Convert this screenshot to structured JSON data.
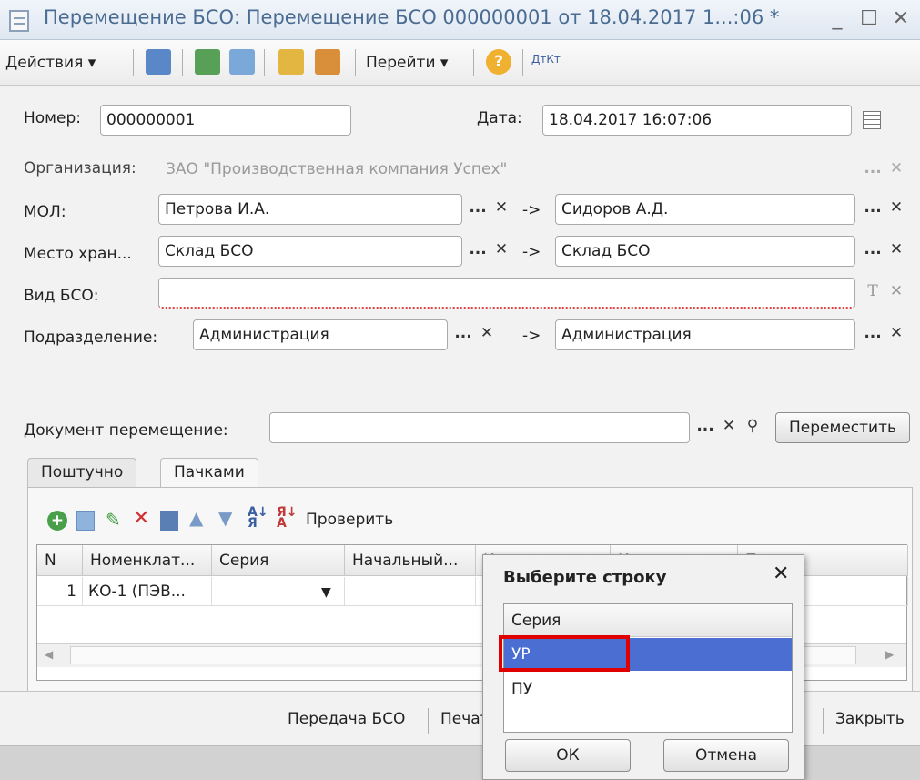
{
  "window": {
    "title": "Перемещение БСО: Перемещение БСО 000000001 от 18.04.2017 1...:06 *",
    "min": "_",
    "max": "☐",
    "close": "✕"
  },
  "toolbar": {
    "actions": "Действия ▾",
    "goto": "Перейти ▾",
    "help": "?",
    "dtkt": "ДтКт"
  },
  "form": {
    "number_label": "Номер:",
    "number_value": "000000001",
    "date_label": "Дата:",
    "date_value": "18.04.2017 16:07:06",
    "org_label": "Организация:",
    "org_value": "ЗАО \"Производственная компания Успех\"",
    "mol_label": "МОЛ:",
    "mol_from": "Петрова И.А.",
    "mol_to": "Сидоров А.Д.",
    "store_label": "Место хран...",
    "store_from": "Склад БСО",
    "store_to": "Склад БСО",
    "kind_label": "Вид БСО:",
    "kind_value": "",
    "dept_label": "Подразделение:",
    "dept_from": "Администрация",
    "dept_to": "Администрация",
    "arrow": "->",
    "dots": "...",
    "x": "✕",
    "t": "T",
    "doc_move_label": "Документ перемещение:",
    "move_button": "Переместить"
  },
  "tabs": [
    "Поштучно",
    "Пачками"
  ],
  "grid_toolbar": {
    "check": "Проверить"
  },
  "grid": {
    "columns": [
      "N",
      "Номенклат...",
      "Серия",
      "Начальный...",
      "К",
      "К",
      "П...ока"
    ],
    "rows": [
      [
        "1",
        "КО-1 (ПЭВ...",
        "",
        "",
        "",
        "",
        ""
      ]
    ]
  },
  "statusbar": {
    "transfer": "Передача БСО",
    "print": "Печать",
    "close": "Закрыть"
  },
  "popup": {
    "title": "Выберите строку",
    "column": "Серия",
    "items": [
      "УР",
      "ПУ"
    ],
    "ok": "ОК",
    "cancel": "Отмена",
    "selected_color": "#4a6ed1",
    "highlight_color": "#e00000"
  }
}
